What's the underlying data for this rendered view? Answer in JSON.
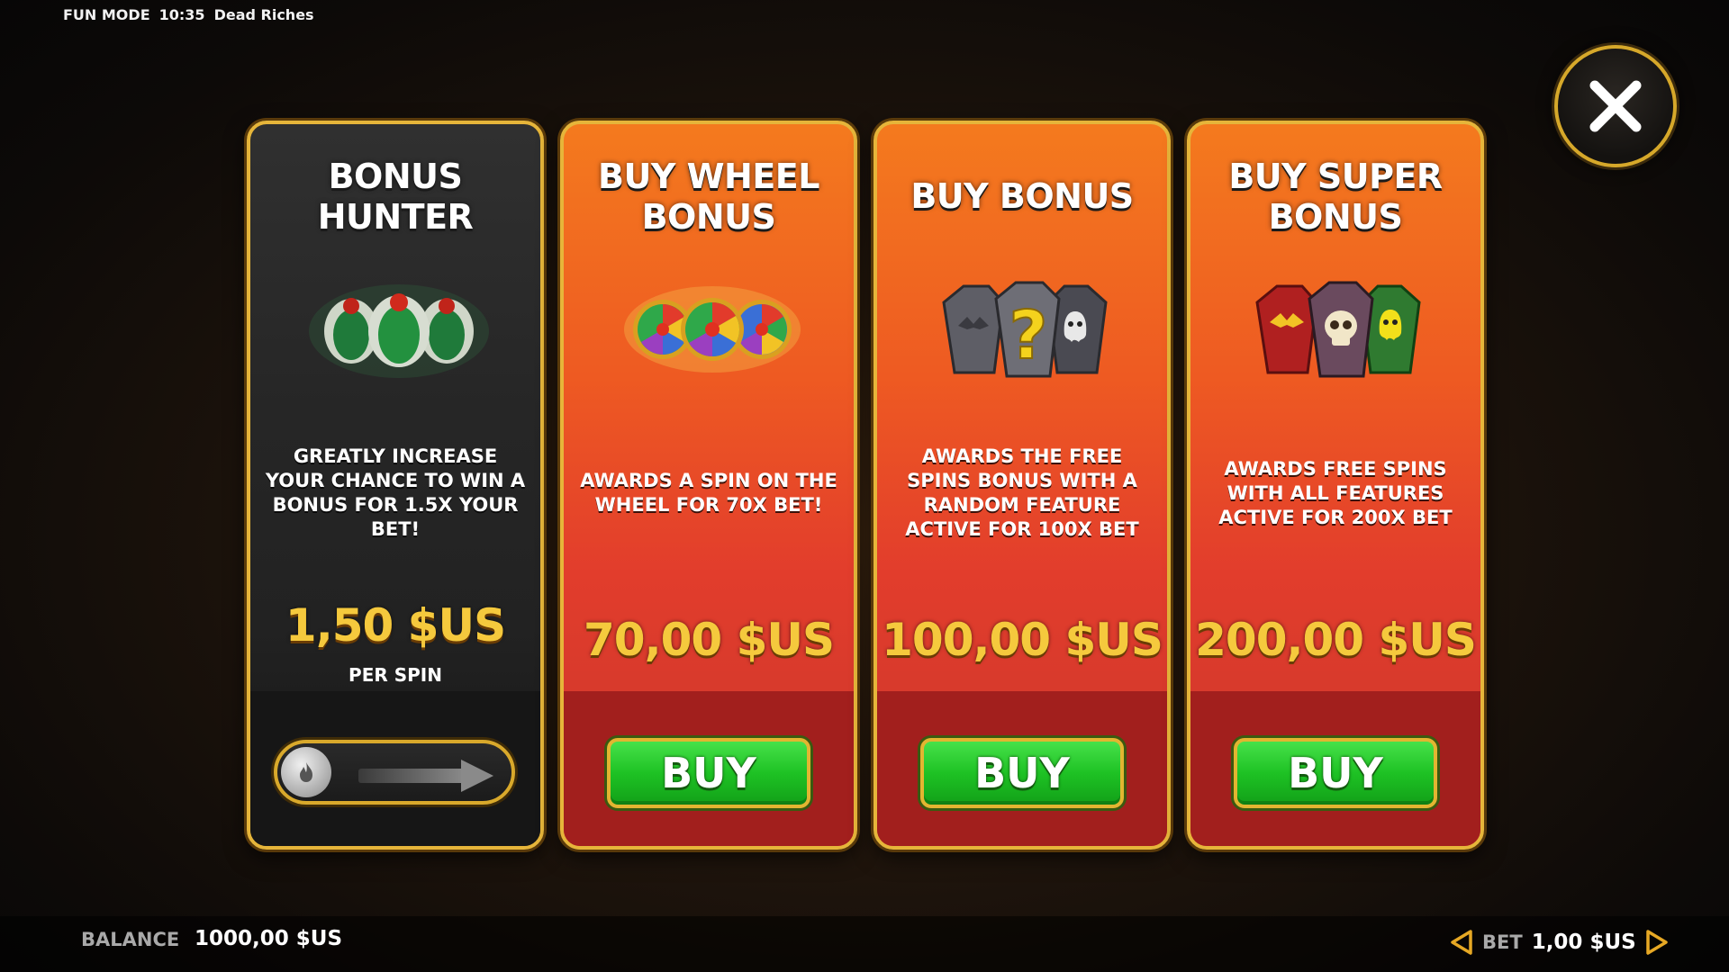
{
  "topbar": {
    "mode": "FUN MODE",
    "time": "10:35",
    "game": "Dead Riches"
  },
  "close": {
    "icon": "close-icon"
  },
  "cards": [
    {
      "title": "BONUS\nHUNTER",
      "icon": "scarab-icon",
      "description": "GREATLY INCREASE YOUR CHANCE TO WIN A BONUS FOR 1.5X YOUR BET!",
      "price": "1,50 $US",
      "subtitle": "PER SPIN",
      "control": "toggle"
    },
    {
      "title": "BUY WHEEL\nBONUS",
      "icon": "wheel-icon",
      "description": "AWARDS A SPIN ON THE WHEEL FOR 70X BET!",
      "price": "70,00 $US",
      "button": "BUY"
    },
    {
      "title": "BUY BONUS",
      "icon": "coffin-mystery-icon",
      "description": "AWARDS THE FREE SPINS BONUS WITH A RANDOM FEATURE ACTIVE FOR 100X BET",
      "price": "100,00 $US",
      "button": "BUY"
    },
    {
      "title": "BUY SUPER\nBONUS",
      "icon": "coffins-icon",
      "description": "AWARDS FREE SPINS WITH ALL FEATURES ACTIVE FOR 200X BET",
      "price": "200,00 $US",
      "button": "BUY"
    }
  ],
  "footer": {
    "balance_label": "BALANCE",
    "balance_value": "1000,00 $US",
    "bet_label": "BET",
    "bet_value": "1,00 $US"
  },
  "colors": {
    "gold": "#e6b53a",
    "orange": "#f47a1e",
    "red": "#d83a2c",
    "green": "#1ec224",
    "price": "#f5c93d"
  }
}
